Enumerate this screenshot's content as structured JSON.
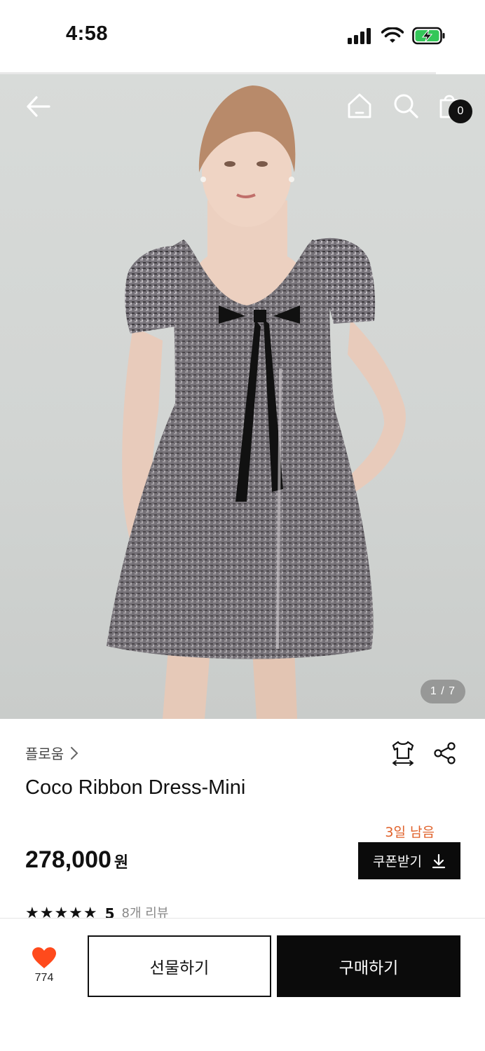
{
  "status_bar": {
    "time": "4:58"
  },
  "header": {
    "back_icon": "arrow-left-icon",
    "home_icon": "home-icon",
    "search_icon": "search-icon",
    "cart_icon": "shopping-bag-icon",
    "cart_count": "0"
  },
  "gallery": {
    "page_indicator": "1 / 7"
  },
  "product": {
    "brand": "플로움",
    "title": "Coco Ribbon Dress-Mini",
    "price": "278,000",
    "currency": "원",
    "coupon_remaining": "3일 남음",
    "coupon_button": "쿠폰받기",
    "rating_stars": "★★★★★",
    "rating": "5",
    "review_count": "8개 리뷰"
  },
  "bottom_bar": {
    "like_count": "774",
    "gift_button": "선물하기",
    "buy_button": "구매하기"
  },
  "colors": {
    "accent_orange": "#e0612a",
    "heart": "#ff4a1c",
    "battery_charge": "#34c759"
  }
}
